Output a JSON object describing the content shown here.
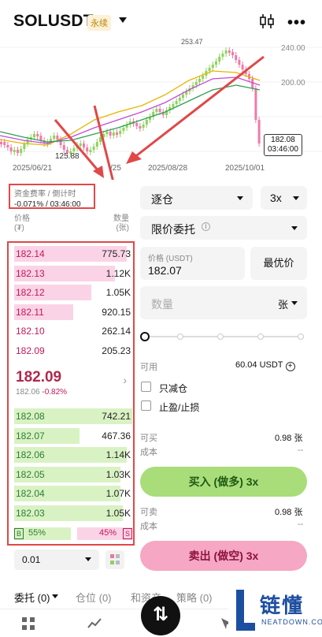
{
  "header": {
    "symbol": "SOLUSDT",
    "tag": "永续"
  },
  "chart": {
    "price_ticks": [
      "240.00",
      "200.00"
    ],
    "dates": [
      "2025/06/21",
      "/25",
      "2025/08/28",
      "2025/10/01"
    ],
    "low_label": "125.88",
    "high_label": "253.47",
    "current_price": "182.08",
    "countdown": "03:46:00"
  },
  "funding": {
    "label": "资金费率 / 倒计时",
    "value": "-0.071% / 03:46:00"
  },
  "book_headers": {
    "price": "价格",
    "price_unit": "(₮)",
    "qty": "数量",
    "qty_unit": "(张)"
  },
  "asks": [
    {
      "price": "182.14",
      "qty": "775.73",
      "depth": 0.95
    },
    {
      "price": "182.13",
      "qty": "1.12K",
      "depth": 0.85
    },
    {
      "price": "182.12",
      "qty": "1.05K",
      "depth": 0.65
    },
    {
      "price": "182.11",
      "qty": "920.15",
      "depth": 0.5
    },
    {
      "price": "182.10",
      "qty": "262.14",
      "depth": 0.0
    },
    {
      "price": "182.09",
      "qty": "205.23",
      "depth": 0.0
    }
  ],
  "mid": {
    "price": "182.09",
    "mark": "182.06",
    "change": "-0.82%"
  },
  "bids": [
    {
      "price": "182.08",
      "qty": "742.21",
      "depth": 1.0
    },
    {
      "price": "182.07",
      "qty": "467.36",
      "depth": 0.55
    },
    {
      "price": "182.06",
      "qty": "1.14K",
      "depth": 0.95
    },
    {
      "price": "182.05",
      "qty": "1.03K",
      "depth": 0.9
    },
    {
      "price": "182.04",
      "qty": "1.07K",
      "depth": 0.9
    },
    {
      "price": "182.03",
      "qty": "1.05K",
      "depth": 0.92
    }
  ],
  "ratio": {
    "buy_label": "B",
    "buy_pct": "55%",
    "sell_pct": "45%",
    "sell_label": "S"
  },
  "depth_select": "0.01",
  "form": {
    "margin_mode": "逐仓",
    "leverage": "3x",
    "order_type": "限价委托",
    "price_label": "价格 (USDT)",
    "price_value": "182.07",
    "best_price_btn": "最优价",
    "qty_placeholder": "数量",
    "qty_unit": "张",
    "available_label": "可用",
    "available_value": "60.04 USDT",
    "reduce_only": "只减仓",
    "tp_sl": "止盈/止损",
    "can_buy_label": "可买",
    "can_buy_value": "0.98 张",
    "cost_label": "成本",
    "cost_value": "--",
    "buy_btn": "买入 (做多) 3x",
    "can_sell_label": "可卖",
    "can_sell_value": "0.98 张",
    "cost2_label": "成本",
    "cost2_value": "--",
    "sell_btn": "卖出 (做空) 3x"
  },
  "tabs": [
    "委托 (0)",
    "仓位 (0)",
    "和资产",
    "策略 (0)"
  ],
  "fab_label": "⇅",
  "watermark": {
    "name": "链懂",
    "domain": "NEATDOWN.COM"
  }
}
